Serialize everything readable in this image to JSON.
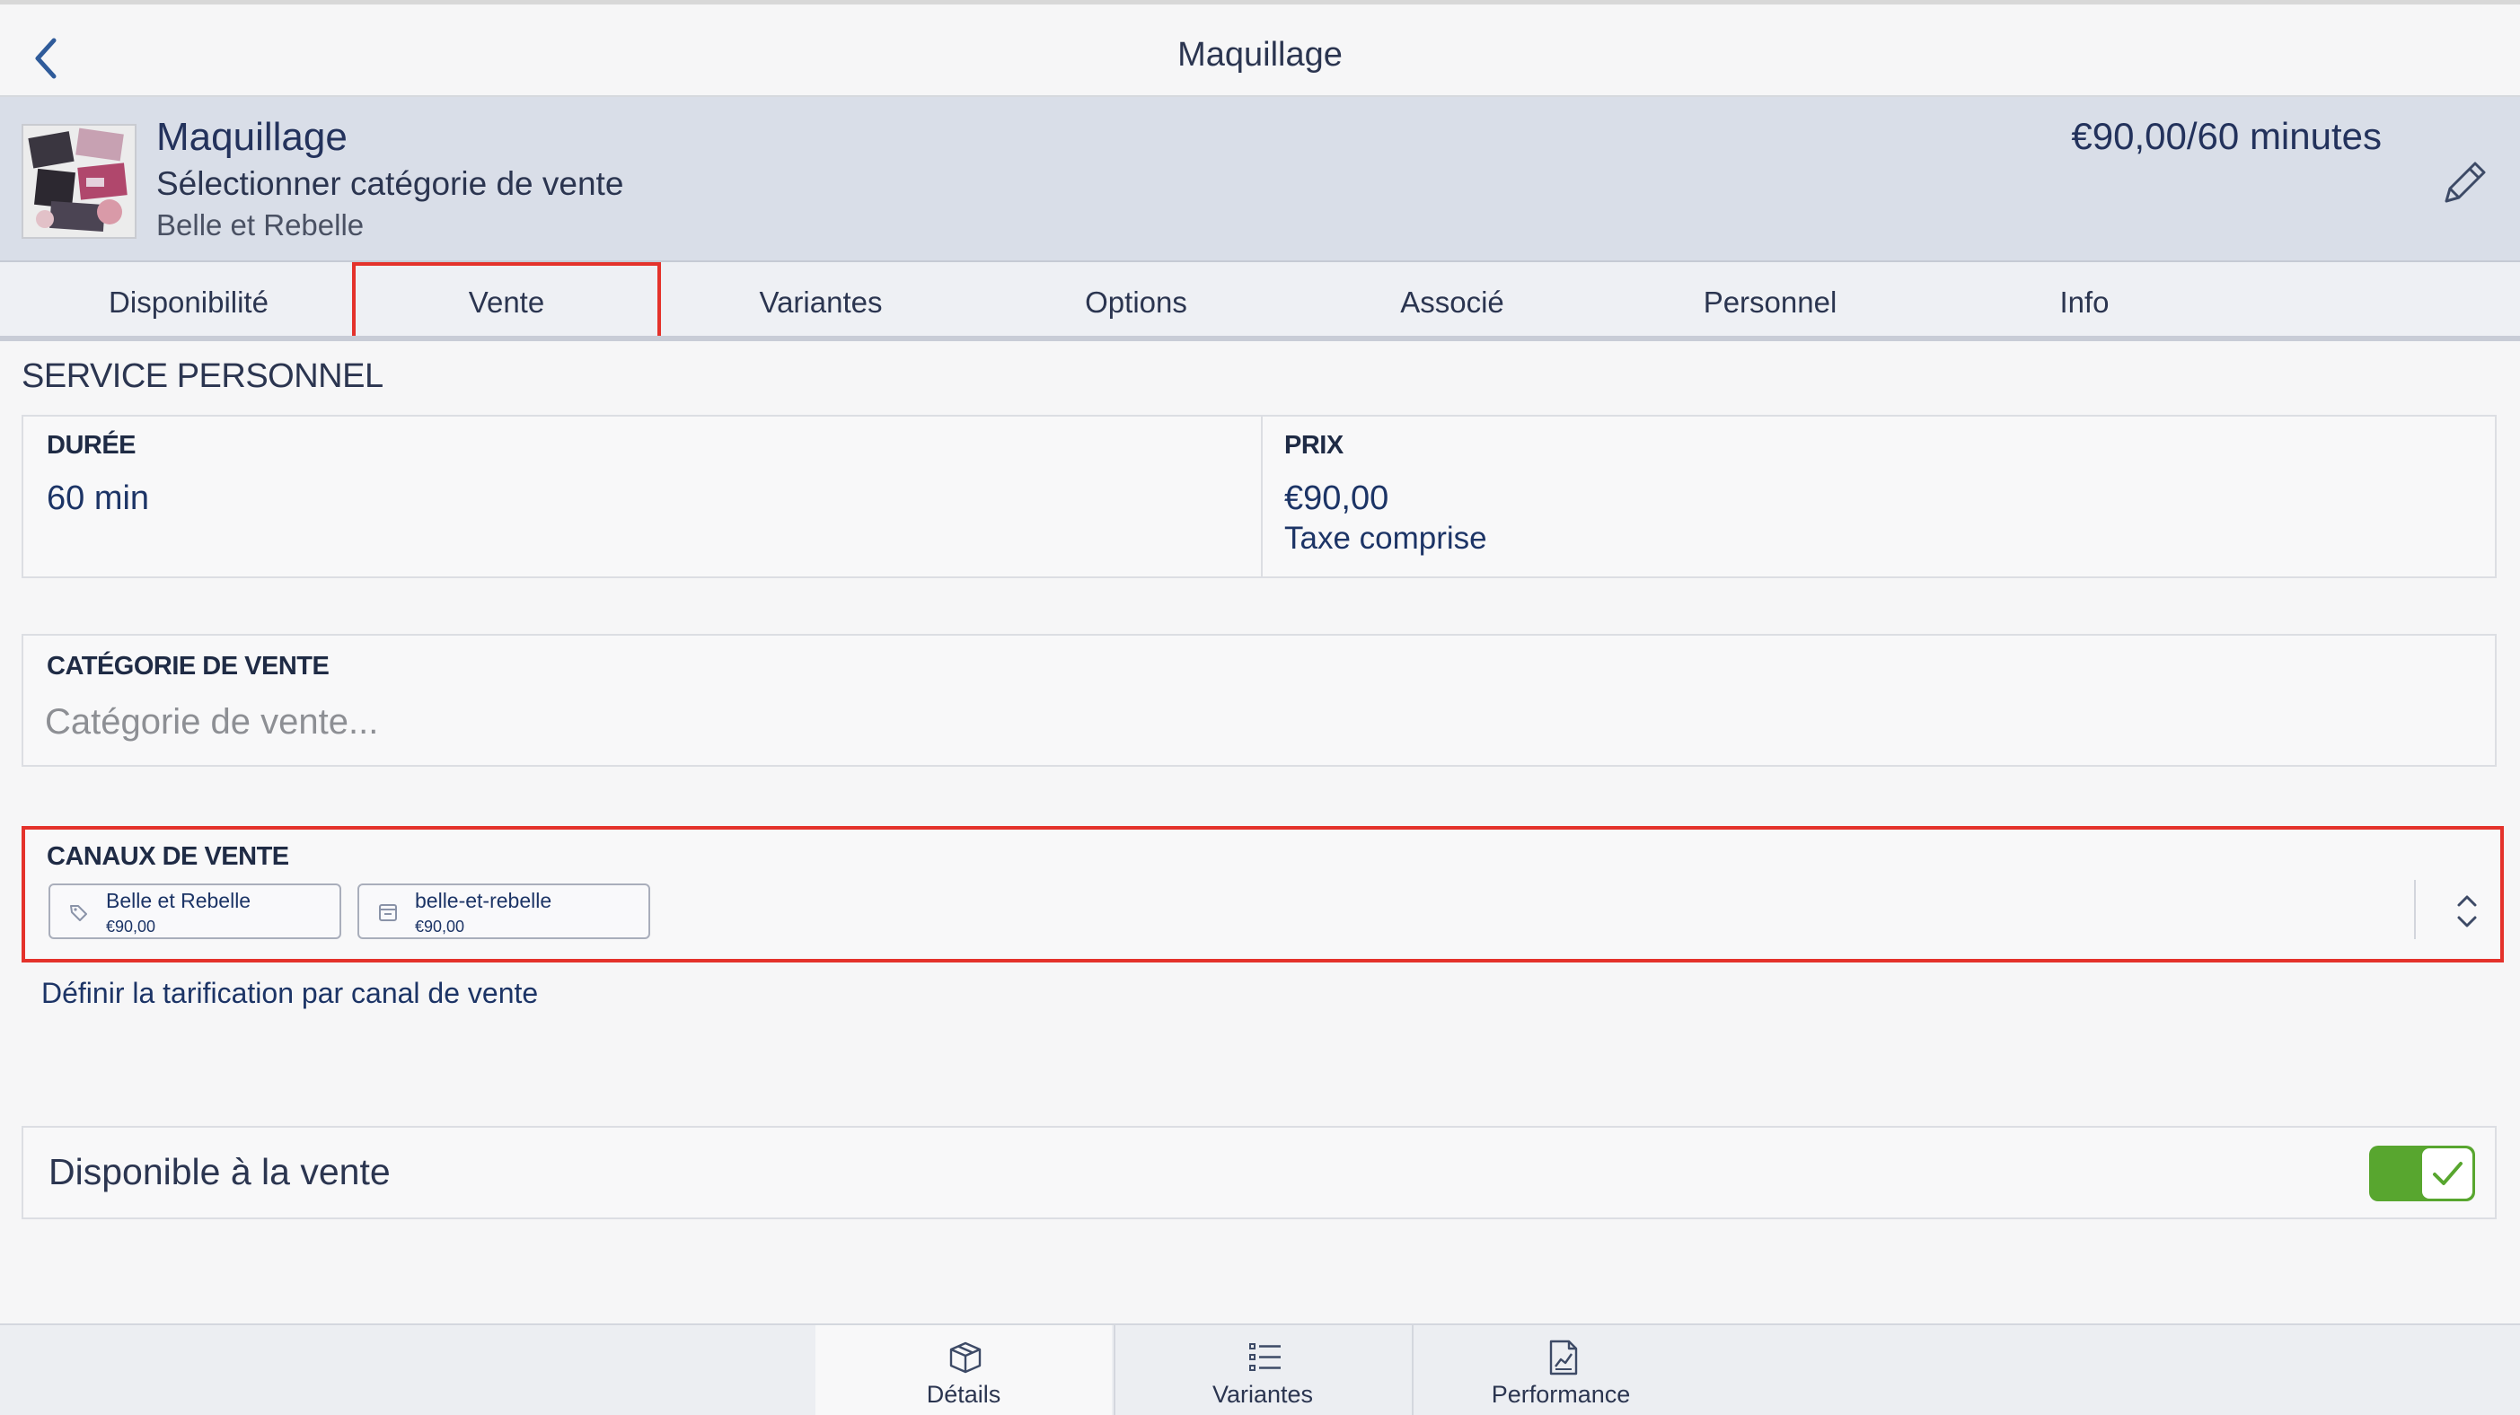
{
  "nav": {
    "title": "Maquillage"
  },
  "header": {
    "name": "Maquillage",
    "category": "Sélectionner catégorie de vente",
    "store": "Belle et Rebelle",
    "price": "€90,00/60 minutes"
  },
  "tabs": [
    {
      "label": "Disponibilité"
    },
    {
      "label": "Vente"
    },
    {
      "label": "Variantes"
    },
    {
      "label": "Options"
    },
    {
      "label": "Associé"
    },
    {
      "label": "Personnel"
    },
    {
      "label": "Info"
    }
  ],
  "active_tab": "Vente",
  "section": {
    "title": "SERVICE PERSONNEL"
  },
  "duration": {
    "label": "DURÉE",
    "value": "60 min"
  },
  "price": {
    "label": "PRIX",
    "value": "€90,00",
    "tax_note": "Taxe comprise"
  },
  "category": {
    "label": "CATÉGORIE DE VENTE",
    "placeholder": "Catégorie de vente..."
  },
  "channels": {
    "label": "CANAUX DE VENTE",
    "items": [
      {
        "name": "Belle et Rebelle",
        "price": "€90,00",
        "icon": "tag-icon"
      },
      {
        "name": "belle-et-rebelle",
        "price": "€90,00",
        "icon": "shop-icon"
      }
    ],
    "link": "Définir la tarification par canal de vente"
  },
  "availability": {
    "label": "Disponible à la vente",
    "enabled": true
  },
  "bottom_tabs": [
    {
      "label": "Détails",
      "icon": "box-icon"
    },
    {
      "label": "Variantes",
      "icon": "list-icon"
    },
    {
      "label": "Performance",
      "icon": "chart-icon"
    }
  ],
  "colors": {
    "accent_navy": "#1c3466",
    "highlight_red": "#e4322b",
    "toggle_green": "#58a62f",
    "header_bg": "#d9dee8"
  }
}
